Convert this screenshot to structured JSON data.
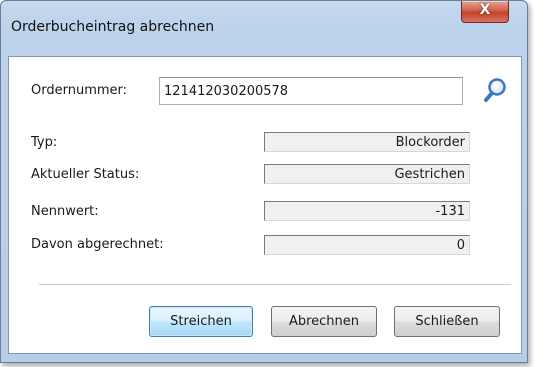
{
  "window": {
    "title": "Orderbucheintrag abrechnen",
    "close_glyph": "X"
  },
  "order": {
    "label": "Ordernummer:",
    "value": "121412030200578",
    "search_icon": "magnifier-icon"
  },
  "fields": [
    {
      "label": "Typ:",
      "value": "Blockorder"
    },
    {
      "label": "Aktueller Status:",
      "value": "Gestrichen"
    },
    {
      "label": "Nennwert:",
      "value": "-131"
    },
    {
      "label": "Davon abgerechnet:",
      "value": "0"
    }
  ],
  "buttons": {
    "streichen": "Streichen",
    "abrechnen": "Abrechnen",
    "schliessen": "Schließen"
  },
  "colors": {
    "window_frame": "#b7cde6",
    "close_button": "#c2422d",
    "default_button": "#bee6fd"
  }
}
